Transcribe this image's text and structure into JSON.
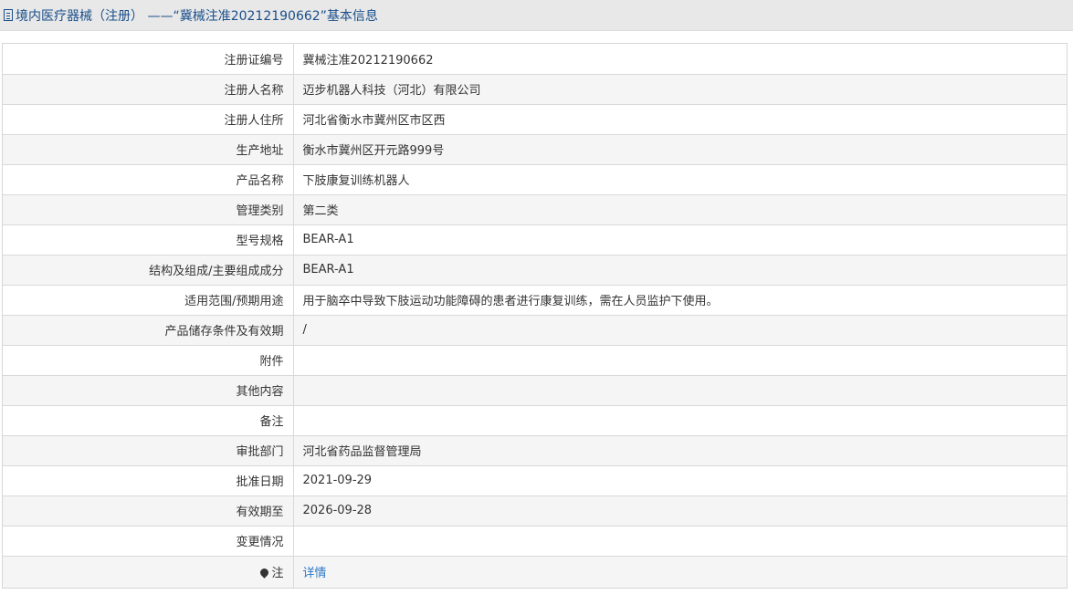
{
  "header": {
    "title": "境内医疗器械（注册） ——“冀械注准20212190662”基本信息"
  },
  "rows": [
    {
      "label": "注册证编号",
      "value": "冀械注准20212190662"
    },
    {
      "label": "注册人名称",
      "value": "迈步机器人科技（河北）有限公司"
    },
    {
      "label": "注册人住所",
      "value": "河北省衡水市冀州区市区西"
    },
    {
      "label": "生产地址",
      "value": "衡水市冀州区开元路999号"
    },
    {
      "label": "产品名称",
      "value": "下肢康复训练机器人"
    },
    {
      "label": "管理类别",
      "value": "第二类"
    },
    {
      "label": "型号规格",
      "value": "BEAR-A1"
    },
    {
      "label": "结构及组成/主要组成成分",
      "value": "BEAR-A1"
    },
    {
      "label": "适用范围/预期用途",
      "value": "用于脑卒中导致下肢运动功能障碍的患者进行康复训练，需在人员监护下使用。"
    },
    {
      "label": "产品储存条件及有效期",
      "value": "/"
    },
    {
      "label": "附件",
      "value": ""
    },
    {
      "label": "其他内容",
      "value": ""
    },
    {
      "label": "备注",
      "value": ""
    },
    {
      "label": "审批部门",
      "value": "河北省药品监督管理局"
    },
    {
      "label": "批准日期",
      "value": "2021-09-29"
    },
    {
      "label": "有效期至",
      "value": "2026-09-28"
    },
    {
      "label": "变更情况",
      "value": ""
    }
  ],
  "note_row": {
    "label": "注",
    "icon": "pin-icon",
    "link": "详情"
  },
  "colors": {
    "header_text": "#1a4f8b",
    "link": "#2a78c8",
    "alt_row": "#f5f5f5"
  }
}
